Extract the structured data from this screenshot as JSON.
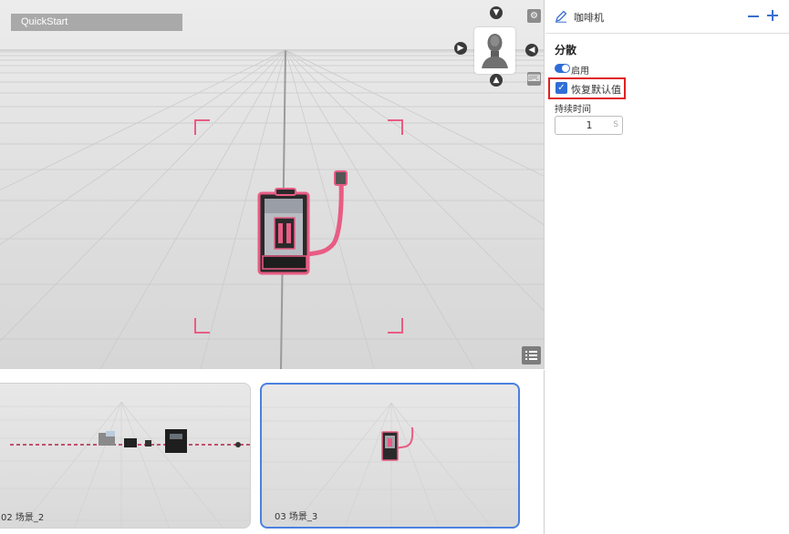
{
  "viewport": {
    "project_title": "QuickStart"
  },
  "navigator": {
    "up_icon": "chevron-up-icon",
    "down_icon": "chevron-down-icon",
    "left_icon": "chevron-left-icon",
    "right_icon": "chevron-right-icon",
    "camera_preview": "head-bust-icon"
  },
  "toolbar": {
    "settings_icon": "camera-settings-icon",
    "keyboard_icon": "keyboard-icon",
    "list_icon": "list-icon"
  },
  "panel": {
    "object_name": "咖啡机",
    "section_title": "分散",
    "enable_label": "启用",
    "enabled": true,
    "reset_label": "恢复默认值",
    "reset_checked": true,
    "duration_label": "持续时间",
    "duration_value": "1",
    "duration_unit": "S"
  },
  "scenes": [
    {
      "label": "02  场景_2",
      "selected": false
    },
    {
      "label": "03   场景_3",
      "selected": true
    }
  ],
  "colors": {
    "accent": "#2f6ed6",
    "highlight": "#e02020",
    "selection_outline": "#e85c84"
  }
}
